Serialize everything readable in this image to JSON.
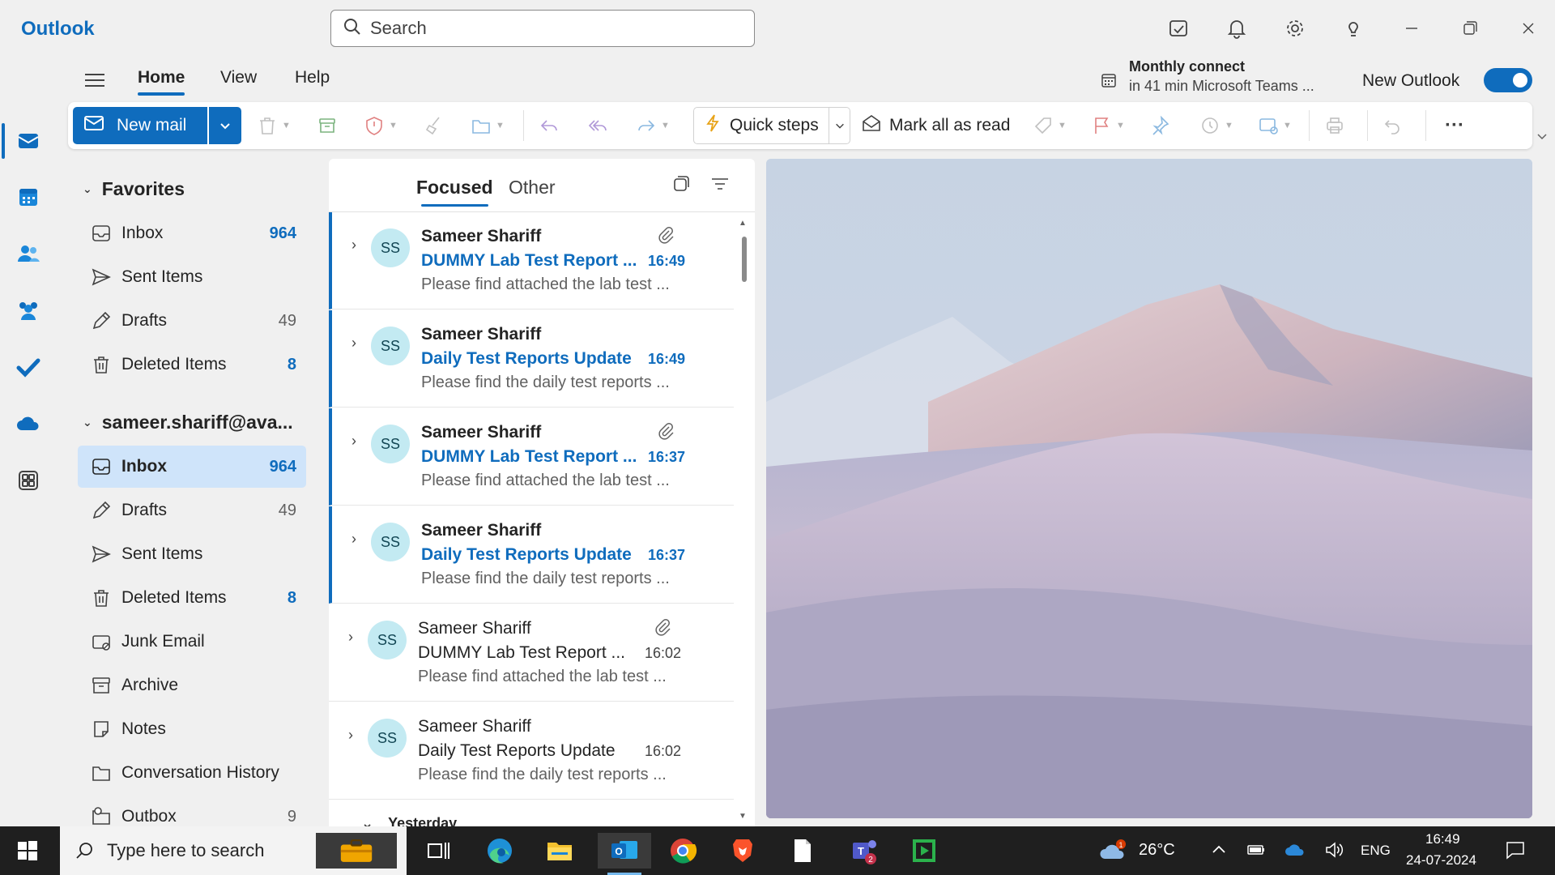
{
  "app": {
    "title": "Outlook"
  },
  "search": {
    "placeholder": "Search"
  },
  "menu": {
    "tabs": [
      "Home",
      "View",
      "Help"
    ],
    "active": "Home"
  },
  "reminder": {
    "title": "Monthly connect",
    "subtitle": "in 41 min Microsoft Teams ..."
  },
  "new_outlook": {
    "label": "New Outlook",
    "enabled": true
  },
  "ribbon": {
    "new_mail": "New mail",
    "quick_steps": "Quick steps",
    "mark_all_read": "Mark all as read",
    "more": "···"
  },
  "favorites": {
    "header": "Favorites",
    "items": [
      {
        "name": "Inbox",
        "count": "964",
        "icon": "inbox-icon"
      },
      {
        "name": "Sent Items",
        "count": "",
        "icon": "send-icon"
      },
      {
        "name": "Drafts",
        "count": "49",
        "icon": "pencil-icon"
      },
      {
        "name": "Deleted Items",
        "count": "8",
        "icon": "trash-icon"
      }
    ]
  },
  "account": {
    "header": "sameer.shariff@ava...",
    "items": [
      {
        "name": "Inbox",
        "count": "964",
        "icon": "inbox-icon"
      },
      {
        "name": "Drafts",
        "count": "49",
        "icon": "pencil-icon"
      },
      {
        "name": "Sent Items",
        "count": "",
        "icon": "send-icon"
      },
      {
        "name": "Deleted Items",
        "count": "8",
        "icon": "trash-icon"
      },
      {
        "name": "Junk Email",
        "count": "",
        "icon": "junk-icon"
      },
      {
        "name": "Archive",
        "count": "",
        "icon": "archive-icon"
      },
      {
        "name": "Notes",
        "count": "",
        "icon": "note-icon"
      },
      {
        "name": "Conversation History",
        "count": "",
        "icon": "folder-icon"
      },
      {
        "name": "Outbox",
        "count": "9",
        "icon": "outbox-icon"
      }
    ]
  },
  "list": {
    "tabs": {
      "focused": "Focused",
      "other": "Other"
    },
    "messages": [
      {
        "initials": "SS",
        "sender": "Sameer Shariff",
        "subject": "DUMMY Lab Test Report ...",
        "time": "16:49",
        "preview": "Please find attached the lab test ...",
        "unread": true,
        "attachment": true
      },
      {
        "initials": "SS",
        "sender": "Sameer Shariff",
        "subject": "Daily Test Reports Update",
        "time": "16:49",
        "preview": "Please find the daily test reports ...",
        "unread": true,
        "attachment": false
      },
      {
        "initials": "SS",
        "sender": "Sameer Shariff",
        "subject": "DUMMY Lab Test Report ...",
        "time": "16:37",
        "preview": "Please find attached the lab test ...",
        "unread": true,
        "attachment": true
      },
      {
        "initials": "SS",
        "sender": "Sameer Shariff",
        "subject": "Daily Test Reports Update",
        "time": "16:37",
        "preview": "Please find the daily test reports ...",
        "unread": true,
        "attachment": false
      },
      {
        "initials": "SS",
        "sender": "Sameer Shariff",
        "subject": "DUMMY Lab Test Report ...",
        "time": "16:02",
        "preview": "Please find attached the lab test ...",
        "unread": false,
        "attachment": true
      },
      {
        "initials": "SS",
        "sender": "Sameer Shariff",
        "subject": "Daily Test Reports Update",
        "time": "16:02",
        "preview": "Please find the daily test reports ...",
        "unread": false,
        "attachment": false
      }
    ],
    "next_group": "Yesterday"
  },
  "taskbar": {
    "search_placeholder": "Type here to search",
    "weather": "26°C",
    "weather_badge": "1",
    "teams_badge": "2",
    "language": "ENG",
    "time": "16:49",
    "date": "24-07-2024"
  },
  "colors": {
    "accent": "#0f6cbd",
    "selected": "#cfe4fa",
    "avatar": "#c3eaf2"
  }
}
